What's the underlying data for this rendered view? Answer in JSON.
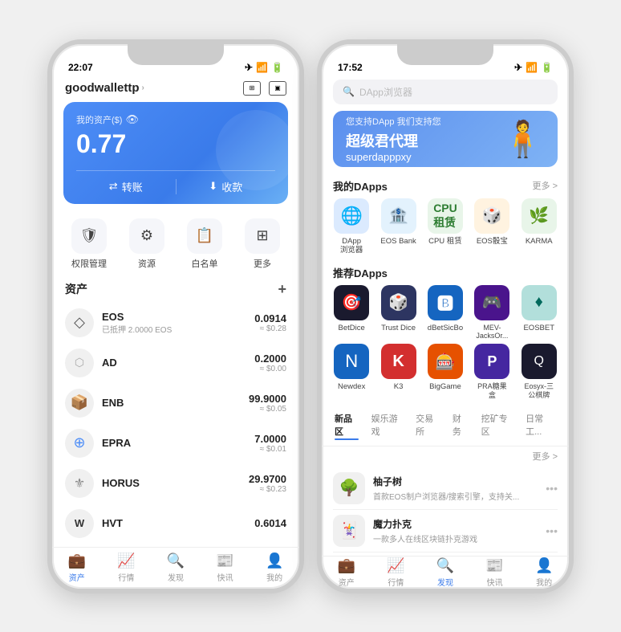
{
  "left_phone": {
    "status_time": "22:07",
    "header": {
      "title": "goodwallettp",
      "chevron": "›"
    },
    "asset_card": {
      "label": "我的资产($)",
      "amount": "0.77",
      "transfer_btn": "转账",
      "receive_btn": "收款"
    },
    "quick_nav": [
      {
        "label": "权限管理",
        "icon": "🛡"
      },
      {
        "label": "资源",
        "icon": "⚙"
      },
      {
        "label": "白名单",
        "icon": "📋"
      },
      {
        "label": "更多",
        "icon": "⊞"
      }
    ],
    "asset_list_title": "资产",
    "assets": [
      {
        "icon": "◇",
        "name": "EOS",
        "sub": "已抵押 2.0000 EOS",
        "amount": "0.0914",
        "usd": "≈ $0.28"
      },
      {
        "icon": "⬡",
        "name": "AD",
        "sub": "",
        "amount": "0.2000",
        "usd": "≈ $0.00"
      },
      {
        "icon": "📦",
        "name": "ENB",
        "sub": "",
        "amount": "99.9000",
        "usd": "≈ $0.05"
      },
      {
        "icon": "⊕",
        "name": "EPRA",
        "sub": "",
        "amount": "7.0000",
        "usd": "≈ $0.01"
      },
      {
        "icon": "⚜",
        "name": "HORUS",
        "sub": "",
        "amount": "29.9700",
        "usd": "≈ $0.23"
      },
      {
        "icon": "W",
        "name": "HVT",
        "sub": "",
        "amount": "0.6014",
        "usd": ""
      }
    ],
    "tabs": [
      {
        "label": "资产",
        "icon": "💼",
        "active": true
      },
      {
        "label": "行情",
        "icon": "📈",
        "active": false
      },
      {
        "label": "发现",
        "icon": "🔍",
        "active": false
      },
      {
        "label": "快讯",
        "icon": "📰",
        "active": false
      },
      {
        "label": "我的",
        "icon": "👤",
        "active": false
      }
    ]
  },
  "right_phone": {
    "status_time": "17:52",
    "search_placeholder": "DApp浏览器",
    "banner": {
      "small_text": "您支持DApp 我们支持您",
      "big_text": "超级君代理",
      "sub_text": "superdapppxy"
    },
    "my_dapps_title": "我的DApps",
    "more_label": "更多 >",
    "my_dapps": [
      {
        "icon": "🌐",
        "label": "DApp\n浏览器",
        "bg": "#e8f0fe"
      },
      {
        "icon": "🏦",
        "label": "EOS Bank",
        "bg": "#e3f0fb"
      },
      {
        "icon": "⚡",
        "label": "CPU 租赁",
        "bg": "#e8fce8"
      },
      {
        "icon": "🎲",
        "label": "EOS骰宝",
        "bg": "#fff3e0"
      },
      {
        "icon": "🌿",
        "label": "KARMA",
        "bg": "#e8f5e9"
      }
    ],
    "recommended_title": "推荐DApps",
    "recommended_dapps_row1": [
      {
        "icon": "🎯",
        "label": "BetDice",
        "bg": "#1a1a2e"
      },
      {
        "icon": "🎲",
        "label": "Trust Dice",
        "bg": "#2d3561"
      },
      {
        "icon": "🅱",
        "label": "dBetSicBo",
        "bg": "#1565c0"
      },
      {
        "icon": "🎮",
        "label": "MEV-\nJacksOr...",
        "bg": "#4a148c"
      },
      {
        "icon": "♦",
        "label": "EOSBET",
        "bg": "#b2dfdb"
      }
    ],
    "recommended_dapps_row2": [
      {
        "icon": "N",
        "label": "Newdex",
        "bg": "#1565c0"
      },
      {
        "icon": "K",
        "label": "K3",
        "bg": "#d32f2f"
      },
      {
        "icon": "🎰",
        "label": "BigGame",
        "bg": "#e65100"
      },
      {
        "icon": "P",
        "label": "PRA糖果\n盒",
        "bg": "#4527a0"
      },
      {
        "icon": "Q",
        "label": "Eosyx-三\n公棋牌",
        "bg": "#1a1a2e"
      }
    ],
    "tabs_row": [
      {
        "label": "新品区",
        "active": true
      },
      {
        "label": "娱乐游戏",
        "active": false
      },
      {
        "label": "交易所",
        "active": false
      },
      {
        "label": "财务",
        "active": false
      },
      {
        "label": "挖矿专区",
        "active": false
      },
      {
        "label": "日常工...",
        "active": false
      }
    ],
    "new_items": [
      {
        "icon": "🌳",
        "title": "柚子树",
        "desc": "首款EOS制户浏览器/搜索引擎，支持关..."
      },
      {
        "icon": "🃏",
        "title": "魔力扑克",
        "desc": "一款多人在线区块链扑克游戏"
      }
    ],
    "tabs": [
      {
        "label": "资产",
        "icon": "💼",
        "active": false
      },
      {
        "label": "行情",
        "icon": "📈",
        "active": false
      },
      {
        "label": "发现",
        "icon": "🔍",
        "active": true
      },
      {
        "label": "快讯",
        "icon": "📰",
        "active": false
      },
      {
        "label": "我的",
        "icon": "👤",
        "active": false
      }
    ]
  }
}
